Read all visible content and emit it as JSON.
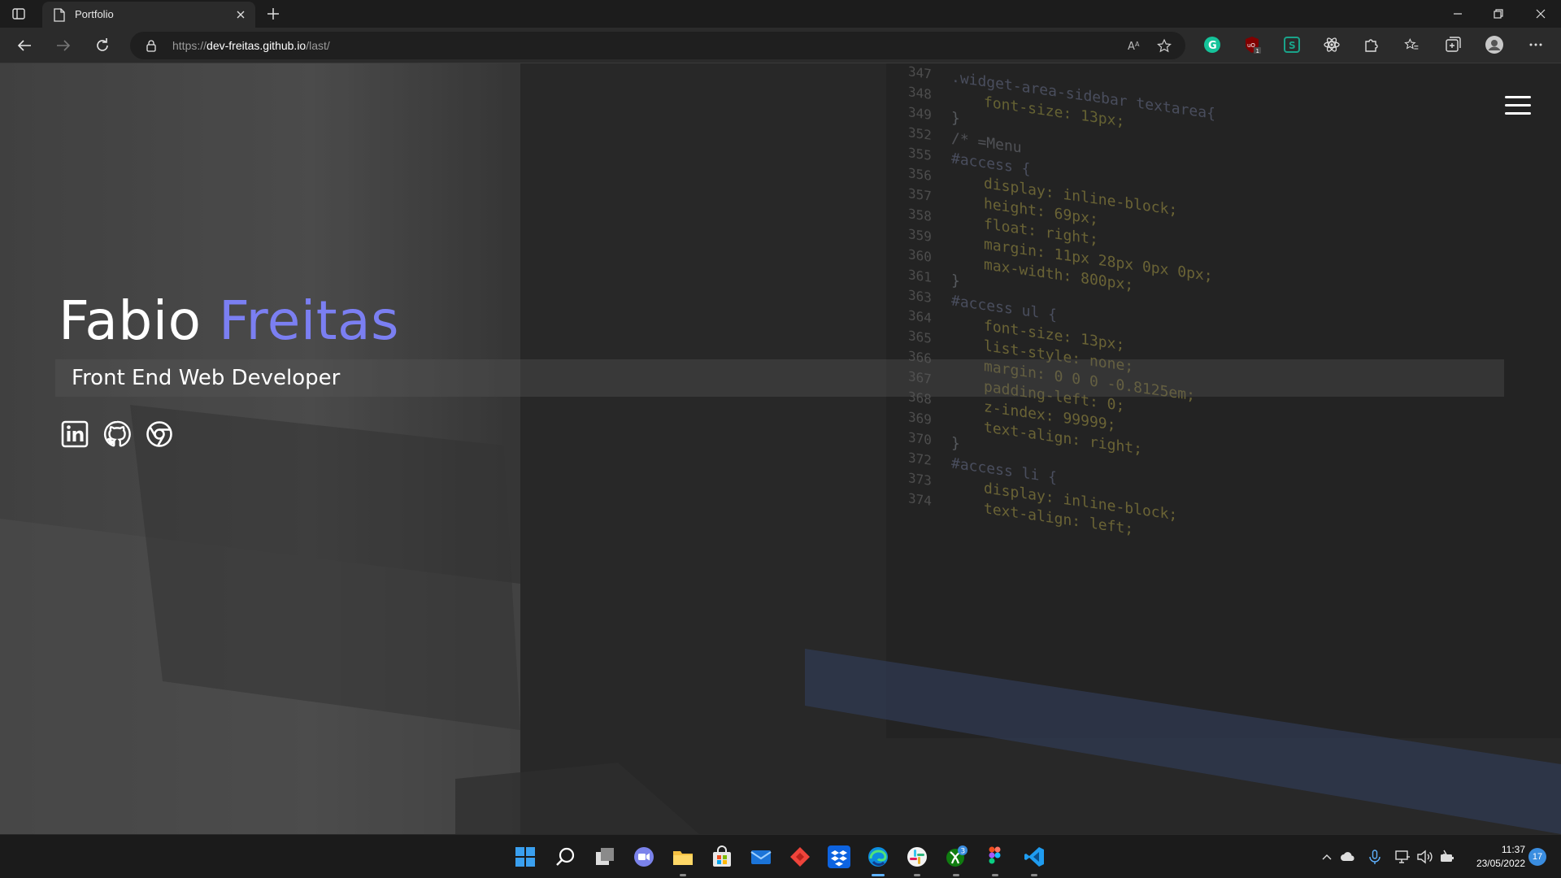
{
  "browser": {
    "tab_title": "Portfolio",
    "url_scheme": "https://",
    "url_host": "dev-freitas.github.io",
    "url_path": "/last/",
    "extension_badge": "1"
  },
  "hero": {
    "first_name": "Fabio",
    "last_name": "Freitas",
    "tagline": "Front End Web Developer",
    "accent_color": "#7b7ff2",
    "social_links": [
      "linkedin-icon",
      "github-icon",
      "chrome-icon"
    ],
    "background_code": [
      "347",
      ".widget-area-sidebar textarea{",
      "348",
      "font-size: 13px;",
      "349",
      "}",
      "352",
      "/* =Menu",
      "355",
      "#access {",
      "356",
      "display: inline-block;",
      "357",
      "height: 69px;",
      "358",
      "float: right;",
      "359",
      "margin: 11px 28px 0px 0px;",
      "360",
      "max-width: 800px;",
      "361",
      "}",
      "363",
      "#access ul {",
      "364",
      "font-size: 13px;",
      "365",
      "list-style: none;",
      "366",
      "margin: 0 0 0 -0.8125em;",
      "367",
      "padding-left: 0;",
      "368",
      "z-index: 99999;",
      "369",
      "text-align: right;",
      "370",
      "}",
      "372",
      "#access li {",
      "373",
      "display: inline-block;",
      "374",
      "text-align: left;"
    ]
  },
  "taskbar": {
    "time": "11:37",
    "date": "23/05/2022",
    "notification_count": "17",
    "xbox_badge": "3"
  }
}
